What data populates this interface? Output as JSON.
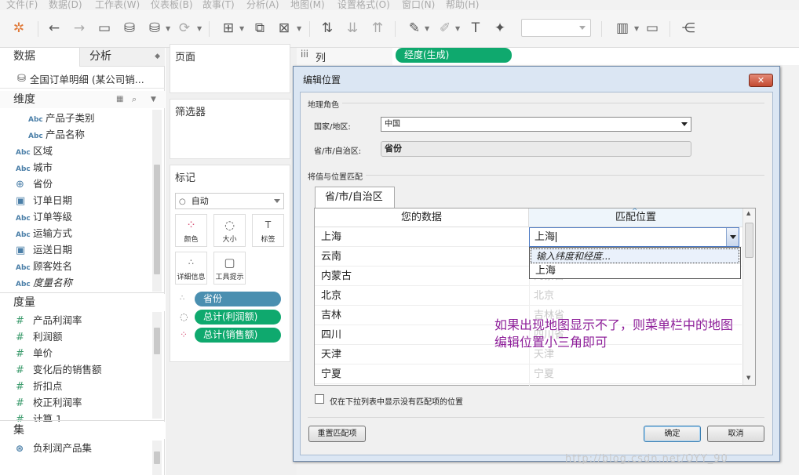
{
  "menu": [
    "文件(F)",
    "数据(D)",
    "工作表(W)",
    "仪表板(B)",
    "故事(T)",
    "分析(A)",
    "地图(M)",
    "设置格式(O)",
    "窗口(N)",
    "帮助(H)"
  ],
  "left_tabs": {
    "data": "数据",
    "analytics": "分析"
  },
  "datasource": "全国订单明细 (某公司销...",
  "dimensions_header": "维度",
  "dimensions": [
    {
      "type": "Abc",
      "label": "产品子类别",
      "indent": true
    },
    {
      "type": "Abc",
      "label": "产品名称",
      "indent": true
    },
    {
      "type": "Abc",
      "label": "区域"
    },
    {
      "type": "Abc",
      "label": "城市"
    },
    {
      "type": "globe",
      "label": "省份"
    },
    {
      "type": "date",
      "label": "订单日期"
    },
    {
      "type": "Abc",
      "label": "订单等级"
    },
    {
      "type": "Abc",
      "label": "运输方式"
    },
    {
      "type": "date",
      "label": "运送日期"
    },
    {
      "type": "Abc",
      "label": "顾客姓名"
    },
    {
      "type": "Abc",
      "label": "度量名称"
    }
  ],
  "measures_header": "度量",
  "measures": [
    "产品利润率",
    "利润额",
    "单价",
    "变化后的销售额",
    "折扣点",
    "校正利润率",
    "计算 1"
  ],
  "sets_header": "集",
  "sets": [
    "负利润产品集"
  ],
  "shelves": {
    "pages": "页面",
    "filters": "筛选器",
    "marks": "标记",
    "columns_label": "列",
    "column_pill": "经度(生成)"
  },
  "marks": {
    "type": "自动",
    "buttons": [
      "颜色",
      "大小",
      "标签",
      "详细信息",
      "工具提示"
    ],
    "pills": [
      "省份",
      "总计(利润额)",
      "总计(销售额)"
    ]
  },
  "dialog": {
    "title": "编辑位置",
    "close": "✕",
    "geo_role_group": "地理角色",
    "country_label": "国家/地区:",
    "country_value": "中国",
    "province_label": "省/市/自治区:",
    "province_value": "省份",
    "match_group": "将值与位置匹配",
    "tab": "省/市/自治区",
    "col_your_data": "您的数据",
    "col_match": "匹配位置",
    "rows": [
      {
        "data": "上海",
        "match": "上海"
      },
      {
        "data": "云南",
        "match": ""
      },
      {
        "data": "内蒙古",
        "match": "内蒙古"
      },
      {
        "data": "北京",
        "match": "北京"
      },
      {
        "data": "吉林",
        "match": "吉林省"
      },
      {
        "data": "四川",
        "match": "四川省"
      },
      {
        "data": "天津",
        "match": "天津"
      },
      {
        "data": "宁夏",
        "match": "宁夏"
      }
    ],
    "dropdown_options": [
      "输入纬度和经度...",
      "上海"
    ],
    "checkbox_label": "仅在下拉列表中显示没有匹配项的位置",
    "reset_button": "重置匹配项",
    "ok_button": "确定",
    "cancel_button": "取消"
  },
  "annotation": [
    "如果出现地图显示不了，则菜单栏中的地图",
    "编辑位置小三角即可"
  ],
  "watermark": "http://blog.csdn.net/OYY_90"
}
